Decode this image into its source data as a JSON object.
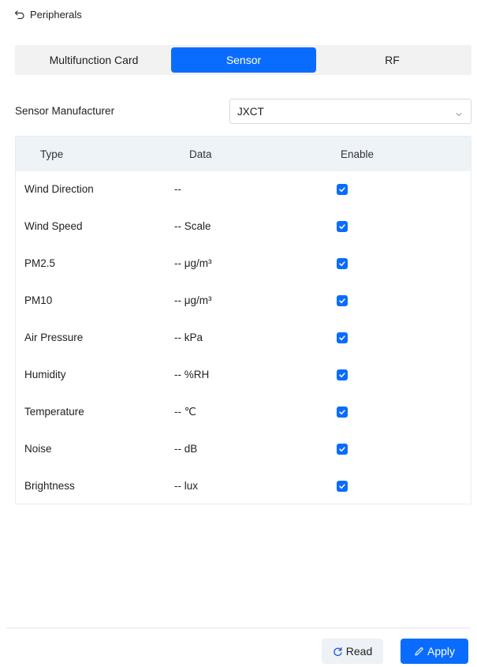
{
  "header": {
    "title": "Peripherals",
    "back_icon": "back-arrow-icon"
  },
  "tabs": [
    {
      "label": "Multifunction Card",
      "active": false
    },
    {
      "label": "Sensor",
      "active": true
    },
    {
      "label": "RF",
      "active": false
    }
  ],
  "manufacturer": {
    "label": "Sensor Manufacturer",
    "value": "JXCT"
  },
  "table": {
    "columns": [
      "Type",
      "Data",
      "Enable"
    ],
    "rows": [
      {
        "type": "Wind Direction",
        "data": "--",
        "enabled": true
      },
      {
        "type": "Wind Speed",
        "data": "-- Scale",
        "enabled": true
      },
      {
        "type": "PM2.5",
        "data": "-- μg/m³",
        "enabled": true
      },
      {
        "type": "PM10",
        "data": "-- μg/m³",
        "enabled": true
      },
      {
        "type": "Air Pressure",
        "data": "-- kPa",
        "enabled": true
      },
      {
        "type": "Humidity",
        "data": "-- %RH",
        "enabled": true
      },
      {
        "type": "Temperature",
        "data": "-- ℃",
        "enabled": true
      },
      {
        "type": "Noise",
        "data": "-- dB",
        "enabled": true
      },
      {
        "type": "Brightness",
        "data": "-- lux",
        "enabled": true
      }
    ]
  },
  "actions": {
    "read_label": "Read",
    "apply_label": "Apply"
  },
  "colors": {
    "accent": "#0a6cff",
    "tab_bg": "#f2f2f2",
    "table_header_bg": "#eef3f8"
  }
}
